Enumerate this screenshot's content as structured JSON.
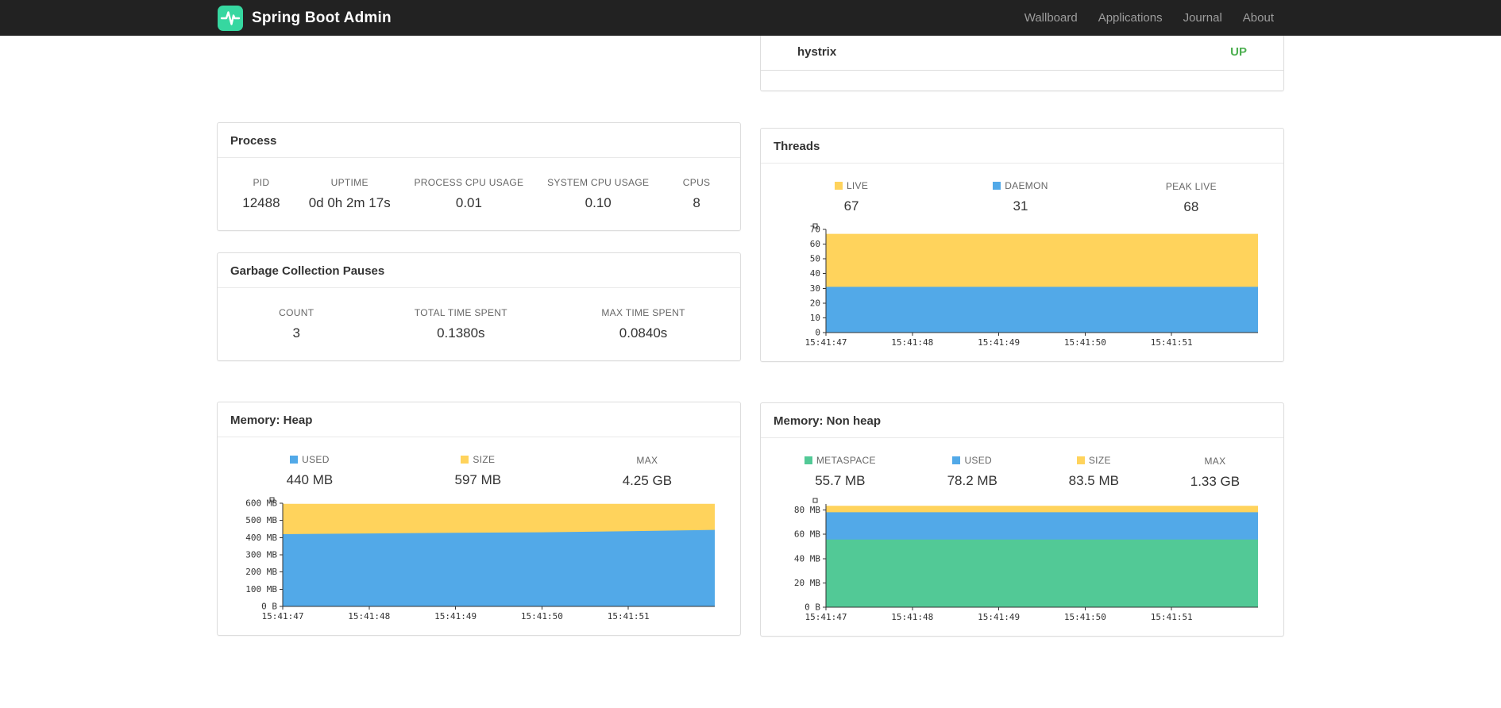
{
  "colors": {
    "navbar_bg": "#222222",
    "brand_logo": "#36D7A0",
    "nav_link": "#9d9d9d",
    "status_up": "#4CAF50",
    "chart_yellow": "#FFD35C",
    "chart_blue": "#52A9E8",
    "chart_green": "#52C996"
  },
  "navbar": {
    "brand": "Spring Boot Admin",
    "links": [
      {
        "label": "Wallboard"
      },
      {
        "label": "Applications"
      },
      {
        "label": "Journal"
      },
      {
        "label": "About"
      }
    ]
  },
  "health": {
    "status_color": "#4CAF50",
    "rows": [
      {
        "name": "hystrix",
        "status": "UP"
      }
    ]
  },
  "panels": {
    "process": {
      "title": "Process",
      "stats": [
        {
          "label": "PID",
          "value": "12488"
        },
        {
          "label": "UPTIME",
          "value": "0d 0h 2m 17s"
        },
        {
          "label": "PROCESS CPU USAGE",
          "value": "0.01"
        },
        {
          "label": "SYSTEM CPU USAGE",
          "value": "0.10"
        },
        {
          "label": "CPUS",
          "value": "8"
        }
      ]
    },
    "gc": {
      "title": "Garbage Collection Pauses",
      "stats": [
        {
          "label": "COUNT",
          "value": "3"
        },
        {
          "label": "TOTAL TIME SPENT",
          "value": "0.1380s"
        },
        {
          "label": "MAX TIME SPENT",
          "value": "0.0840s"
        }
      ]
    },
    "threads": {
      "title": "Threads",
      "legend": [
        {
          "label": "LIVE",
          "value": "67",
          "color": "#FFD35C"
        },
        {
          "label": "DAEMON",
          "value": "31",
          "color": "#52A9E8"
        },
        {
          "label": "PEAK LIVE",
          "value": "68"
        }
      ]
    },
    "heap": {
      "title": "Memory: Heap",
      "legend": [
        {
          "label": "USED",
          "value": "440 MB",
          "color": "#52A9E8"
        },
        {
          "label": "SIZE",
          "value": "597 MB",
          "color": "#FFD35C"
        },
        {
          "label": "MAX",
          "value": "4.25 GB"
        }
      ]
    },
    "nonheap": {
      "title": "Memory: Non heap",
      "legend": [
        {
          "label": "METASPACE",
          "value": "55.7 MB",
          "color": "#52C996"
        },
        {
          "label": "USED",
          "value": "78.2 MB",
          "color": "#52A9E8"
        },
        {
          "label": "SIZE",
          "value": "83.5 MB",
          "color": "#FFD35C"
        },
        {
          "label": "MAX",
          "value": "1.33 GB"
        }
      ]
    }
  },
  "chart_data": [
    {
      "id": "threads",
      "title": "Threads",
      "type": "area",
      "x_labels": [
        "15:41:47",
        "15:41:48",
        "15:41:49",
        "15:41:50",
        "15:41:51"
      ],
      "ymax": 70,
      "yticks": [
        {
          "v": 0,
          "label": "0"
        },
        {
          "v": 10,
          "label": "10"
        },
        {
          "v": 20,
          "label": "20"
        },
        {
          "v": 30,
          "label": "30"
        },
        {
          "v": 40,
          "label": "40"
        },
        {
          "v": 50,
          "label": "50"
        },
        {
          "v": 60,
          "label": "60"
        },
        {
          "v": 70,
          "label": "70"
        }
      ],
      "series": [
        {
          "name": "LIVE",
          "color": "#FFD35C",
          "values": [
            67,
            67,
            67,
            67,
            67,
            67
          ]
        },
        {
          "name": "DAEMON",
          "color": "#52A9E8",
          "values": [
            31,
            31,
            31,
            31,
            31,
            31
          ]
        }
      ]
    },
    {
      "id": "heap",
      "title": "Memory: Heap",
      "type": "area",
      "x_labels": [
        "15:41:47",
        "15:41:48",
        "15:41:49",
        "15:41:50",
        "15:41:51"
      ],
      "ymax": 600,
      "yticks": [
        {
          "v": 0,
          "label": "0 B"
        },
        {
          "v": 100,
          "label": "100 MB"
        },
        {
          "v": 200,
          "label": "200 MB"
        },
        {
          "v": 300,
          "label": "300 MB"
        },
        {
          "v": 400,
          "label": "400 MB"
        },
        {
          "v": 500,
          "label": "500 MB"
        },
        {
          "v": 600,
          "label": "600 MB"
        }
      ],
      "series": [
        {
          "name": "SIZE",
          "color": "#FFD35C",
          "values": [
            597,
            597,
            597,
            597,
            597,
            597
          ]
        },
        {
          "name": "USED",
          "color": "#52A9E8",
          "values": [
            420,
            424,
            428,
            431,
            437,
            445
          ]
        }
      ]
    },
    {
      "id": "nonheap",
      "title": "Memory: Non heap",
      "type": "area",
      "x_labels": [
        "15:41:47",
        "15:41:48",
        "15:41:49",
        "15:41:50",
        "15:41:51"
      ],
      "ymax": 85,
      "yticks": [
        {
          "v": 0,
          "label": "0 B"
        },
        {
          "v": 20,
          "label": "20 MB"
        },
        {
          "v": 40,
          "label": "40 MB"
        },
        {
          "v": 60,
          "label": "60 MB"
        },
        {
          "v": 80,
          "label": "80 MB"
        }
      ],
      "series": [
        {
          "name": "SIZE",
          "color": "#FFD35C",
          "values": [
            83.5,
            83.5,
            83.5,
            83.5,
            83.5,
            83.5
          ]
        },
        {
          "name": "USED",
          "color": "#52A9E8",
          "values": [
            78.2,
            78.2,
            78.2,
            78.2,
            78.2,
            78.2
          ]
        },
        {
          "name": "METASPACE",
          "color": "#52C996",
          "values": [
            55.7,
            55.7,
            55.7,
            55.7,
            55.7,
            55.7
          ]
        }
      ]
    }
  ]
}
